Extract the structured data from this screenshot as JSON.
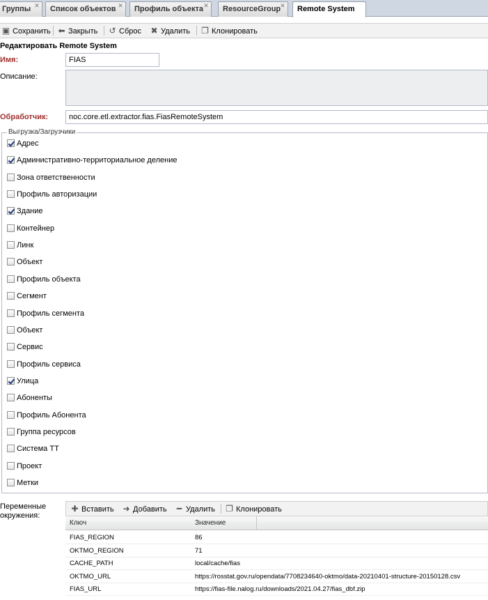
{
  "tabs": [
    {
      "label": "Группы",
      "active": false
    },
    {
      "label": "Список объектов",
      "active": false
    },
    {
      "label": "Профиль объекта",
      "active": false
    },
    {
      "label": "ResourceGroup",
      "active": false
    },
    {
      "label": "Remote System",
      "active": true
    }
  ],
  "toolbar": {
    "save": "Сохранить",
    "close": "Закрыть",
    "reset": "Сброс",
    "delete": "Удалить",
    "clone": "Клонировать"
  },
  "form": {
    "title": "Редактировать Remote System",
    "name_label": "Имя:",
    "name_value": "FIAS",
    "description_label": "Описание:",
    "description_value": "",
    "handler_label": "Обработчик:",
    "handler_value": "noc.core.etl.extractor.fias.FiasRemoteSystem"
  },
  "loaders": {
    "legend": "Выгрузка/Загрузчики",
    "items": [
      {
        "label": "Адрес",
        "checked": true
      },
      {
        "label": "Административно-территориальное деление",
        "checked": true
      },
      {
        "label": "Зона ответственности",
        "checked": false
      },
      {
        "label": "Профиль авторизации",
        "checked": false
      },
      {
        "label": "Здание",
        "checked": true
      },
      {
        "label": "Контейнер",
        "checked": false
      },
      {
        "label": "Линк",
        "checked": false
      },
      {
        "label": "Объект",
        "checked": false
      },
      {
        "label": "Профиль объекта",
        "checked": false
      },
      {
        "label": "Сегмент",
        "checked": false
      },
      {
        "label": "Профиль сегмента",
        "checked": false
      },
      {
        "label": "Объект",
        "checked": false
      },
      {
        "label": "Сервис",
        "checked": false
      },
      {
        "label": "Профиль сервиса",
        "checked": false
      },
      {
        "label": "Улица",
        "checked": true
      },
      {
        "label": "Абоненты",
        "checked": false
      },
      {
        "label": "Профиль Абонента",
        "checked": false
      },
      {
        "label": "Группа ресурсов",
        "checked": false
      },
      {
        "label": "Система ТТ",
        "checked": false
      },
      {
        "label": "Проект",
        "checked": false
      },
      {
        "label": "Метки",
        "checked": false
      }
    ]
  },
  "environment": {
    "label_line1": "Переменные",
    "label_line2": "окружения:",
    "toolbar": {
      "insert": "Вставить",
      "add": "Добавить",
      "delete": "Удалить",
      "clone": "Клонировать"
    },
    "columns": {
      "key": "Ключ",
      "value": "Значение"
    },
    "rows": [
      {
        "key": "FIAS_REGION",
        "value": "86"
      },
      {
        "key": "OKTMO_REGION",
        "value": "71"
      },
      {
        "key": "CACHE_PATH",
        "value": "local/cache/fias"
      },
      {
        "key": "OKTMO_URL",
        "value": "https://rosstat.gov.ru/opendata/7708234640-oktmo/data-20210401-structure-20150128.csv"
      },
      {
        "key": "FIAS_URL",
        "value": "https://fias-file.nalog.ru/downloads/2021.04.27/fias_dbf.zip"
      }
    ]
  }
}
